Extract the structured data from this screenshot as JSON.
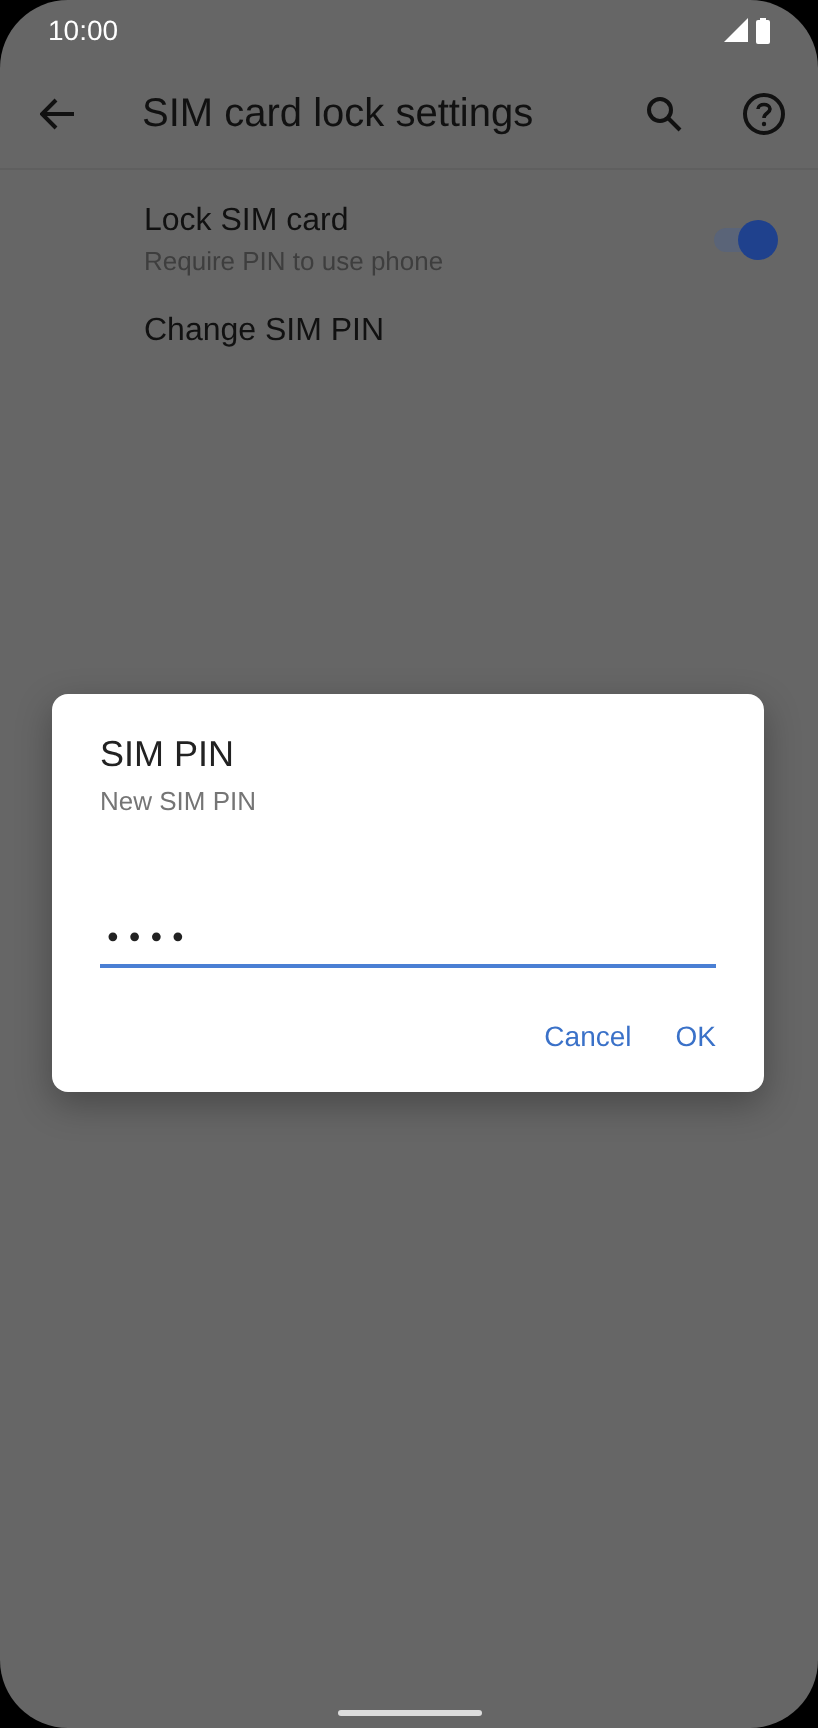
{
  "status_bar": {
    "time": "10:00"
  },
  "app_bar": {
    "title": "SIM card lock settings"
  },
  "settings": [
    {
      "kind": "switch",
      "title": "Lock SIM card",
      "summary": "Require PIN to use phone",
      "on": true
    },
    {
      "kind": "plain",
      "title": "Change SIM PIN"
    }
  ],
  "dialog": {
    "title": "SIM PIN",
    "message": "New SIM PIN",
    "field": {
      "value": "••••",
      "focused": true
    },
    "buttons": [
      "Cancel",
      "OK"
    ]
  }
}
